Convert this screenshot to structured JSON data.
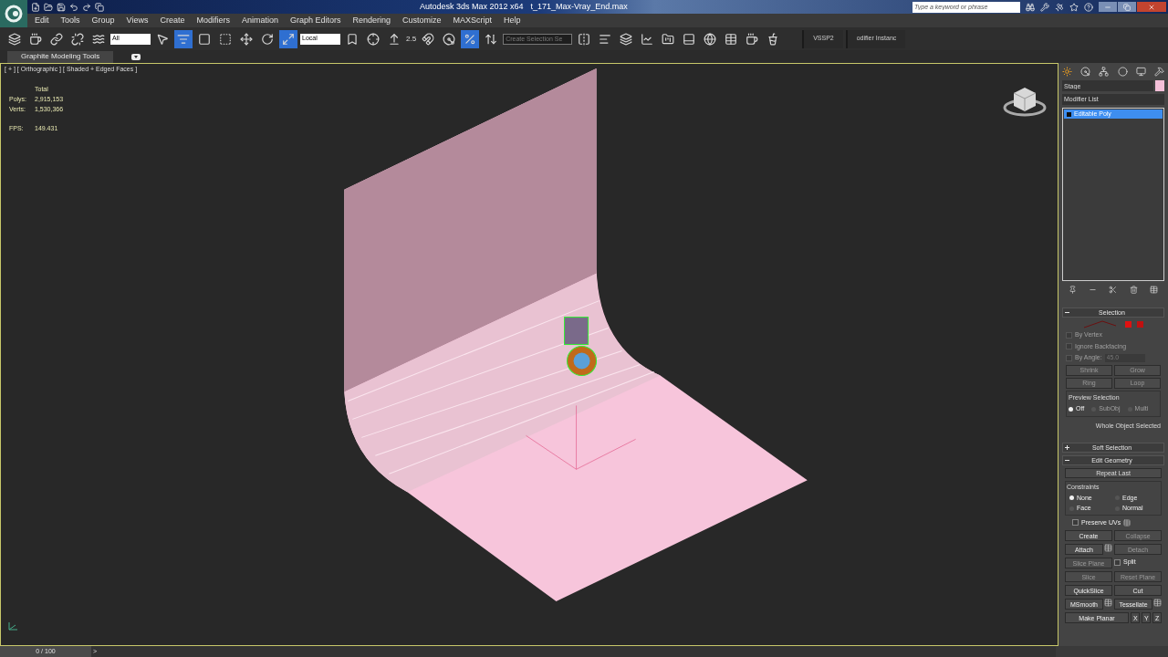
{
  "title_bar": {
    "app_title": "Autodesk 3ds Max 2012 x64",
    "file_name": "t_171_Max-Vray_End.max",
    "search": {
      "placeholder": "Type a keyword or phrase"
    }
  },
  "menu": [
    "Edit",
    "Tools",
    "Group",
    "Views",
    "Create",
    "Modifiers",
    "Animation",
    "Graph Editors",
    "Rendering",
    "Customize",
    "MAXScript",
    "Help"
  ],
  "toolbar": {
    "selection_filter": "All",
    "coordinate_system": "Local",
    "snap_value": "2.5",
    "named_selection": "Create Selection Se",
    "buttons": [
      {
        "selected": false
      },
      {
        "selected": false
      },
      {
        "selected": false
      },
      {
        "selected": false
      },
      {
        "selected": false
      },
      {
        "selected": false
      },
      {
        "selected": true
      },
      {
        "selected": false
      },
      {
        "selected": false
      },
      {
        "selected": false
      },
      {
        "selected": false
      },
      {
        "selected": true
      },
      {
        "selected": false
      },
      {
        "selected": false
      },
      {
        "selected": false
      },
      {
        "selected": false
      },
      {
        "selected": false
      },
      {
        "selected": true
      },
      {
        "selected": false
      },
      {
        "selected": false
      },
      {
        "selected": false
      },
      {
        "selected": false
      },
      {
        "selected": false
      }
    ],
    "tabs": [
      "VSSP2",
      "odifier Instanc"
    ]
  },
  "ribbon": {
    "tab": "Graphite Modeling Tools"
  },
  "viewport": {
    "label": "[ + ] [ Orthographic ] [ Shaded + Edged Faces ]",
    "stats_heading": "Total",
    "stats": [
      {
        "label": "Polys:",
        "value": "2,915,153"
      },
      {
        "label": "Verts:",
        "value": "1,530,366"
      },
      {
        "label": "FPS:",
        "value": "149.431"
      }
    ]
  },
  "command_panel": {
    "object": {
      "name": "Stage",
      "color": "#f4bfd8"
    },
    "modifier_list": "Modifier List",
    "stack": [
      {
        "label": "Editable Poly",
        "selected": true
      }
    ],
    "selection": {
      "title": "Selection",
      "expanded": true,
      "checkboxes": [
        {
          "label": "By Vertex",
          "checked": false,
          "disabled": true
        },
        {
          "label": "Ignore Backfacing",
          "checked": false,
          "disabled": true
        },
        {
          "label": "By Angle:",
          "checked": false,
          "disabled": true,
          "value": "45.0"
        }
      ],
      "buttons": [
        {
          "label": "Shrink",
          "disabled": true
        },
        {
          "label": "Grow",
          "disabled": true
        },
        {
          "label": "Ring",
          "disabled": true
        },
        {
          "label": "Loop",
          "disabled": true
        }
      ],
      "preview": {
        "title": "Preview Selection",
        "options": [
          {
            "label": "Off",
            "selected": true,
            "disabled": false
          },
          {
            "label": "SubObj",
            "selected": false,
            "disabled": true
          },
          {
            "label": "Multi",
            "selected": false,
            "disabled": true
          }
        ]
      },
      "status": "Whole Object Selected"
    },
    "soft_selection": {
      "title": "Soft Selection",
      "expanded": false
    },
    "edit_geometry": {
      "title": "Edit Geometry",
      "expanded": true,
      "repeat_last": "Repeat Last",
      "constraints": {
        "title": "Constraints",
        "options": [
          {
            "label": "None",
            "selected": true
          },
          {
            "label": "Edge",
            "selected": false
          },
          {
            "label": "Face",
            "selected": false
          },
          {
            "label": "Normal",
            "selected": false
          }
        ]
      },
      "preserve_uvs": {
        "label": "Preserve UVs",
        "checked": false
      },
      "rows": [
        [
          {
            "kind": "button",
            "label": "Create",
            "disabled": false
          },
          {
            "kind": "button",
            "label": "Collapse",
            "disabled": true
          }
        ],
        [
          {
            "kind": "button",
            "label": "Attach",
            "disabled": false,
            "settings": true
          },
          {
            "kind": "button",
            "label": "Detach",
            "disabled": true
          }
        ],
        [
          {
            "kind": "button",
            "label": "Slice Plane",
            "disabled": true
          },
          {
            "kind": "checkbox",
            "label": "Split",
            "checked": false,
            "disabled": false
          }
        ],
        [
          {
            "kind": "button",
            "label": "Slice",
            "disabled": true
          },
          {
            "kind": "button",
            "label": "Reset Plane",
            "disabled": true
          }
        ],
        [
          {
            "kind": "button",
            "label": "QuickSlice",
            "disabled": false
          },
          {
            "kind": "button",
            "label": "Cut",
            "disabled": false
          }
        ],
        [
          {
            "kind": "button",
            "label": "MSmooth",
            "disabled": false,
            "settings": true
          },
          {
            "kind": "button",
            "label": "Tessellate",
            "disabled": false,
            "settings": true
          }
        ],
        [
          {
            "kind": "button",
            "label": "Make Planar",
            "disabled": false
          },
          {
            "kind": "small",
            "label": "X",
            "disabled": false
          },
          {
            "kind": "small",
            "label": "Y",
            "disabled": false
          },
          {
            "kind": "small",
            "label": "Z",
            "disabled": false
          }
        ]
      ]
    }
  },
  "time_slider": {
    "position": "0 / 100",
    "level": 0,
    "next": ">"
  }
}
